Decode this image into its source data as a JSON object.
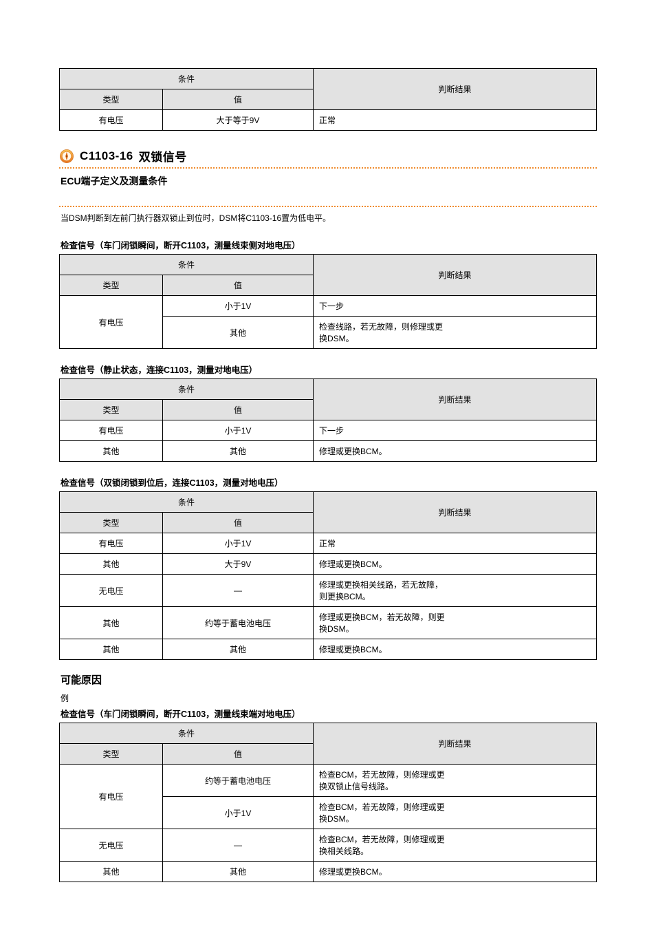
{
  "table0": {
    "h_cond": "条件",
    "h_res": "判断结果",
    "h_type": "类型",
    "h_val": "值",
    "rows": [
      {
        "type": "有电压",
        "val": "大于等于9V",
        "res": "正常"
      }
    ]
  },
  "section": {
    "id": "C1103-16",
    "name": "双锁信号"
  },
  "heading1": "ECU端子定义及测量条件",
  "intro": "当DSM判断到左前门执行器双锁止到位时，DSM将C1103-16置为低电平。",
  "tableA_title": "检查信号（车门闭锁瞬间，断开C1103，测量线束侧对地电压）",
  "tableA": {
    "h_cond": "条件",
    "h_res": "判断结果",
    "h_type": "类型",
    "h_val": "值",
    "rows": [
      {
        "type": "有电压",
        "val": "小于1V",
        "res": "下一步"
      },
      {
        "type": "",
        "val": "其他",
        "res": "检查线路，若无故障，则修理或更\n换DSM。"
      }
    ]
  },
  "tableB_title": "检查信号（静止状态，连接C1103，测量对地电压）",
  "tableB": {
    "h_cond": "条件",
    "h_res": "判断结果",
    "h_type": "类型",
    "h_val": "值",
    "rows": [
      {
        "type": "有电压",
        "val": "小于1V",
        "res": "下一步"
      },
      {
        "type": "其他",
        "val": "其他",
        "res": "修理或更换BCM。"
      }
    ]
  },
  "tableC_title": "检查信号（双锁闭锁到位后，连接C1103，测量对地电压）",
  "tableC": {
    "h_cond": "条件",
    "h_res": "判断结果",
    "h_type": "类型",
    "h_val": "值",
    "rows": [
      {
        "type": "有电压",
        "val": "小于1V",
        "res": "正常"
      },
      {
        "type": "其他",
        "val": "大于9V",
        "res": "修理或更换BCM。"
      },
      {
        "type": "无电压",
        "val": "―",
        "res": "修理或更换相关线路，若无故障，\n则更换BCM。"
      },
      {
        "type": "其他",
        "val": "约等于蓄电池电压",
        "res": "修理或更换BCM，若无故障，则更\n换DSM。"
      },
      {
        "type": "其他",
        "val": "其他",
        "res": "修理或更换BCM。"
      }
    ]
  },
  "heading2": "可能原因",
  "eg": "例",
  "tableD_title": "检查信号（车门闭锁瞬间，断开C1103，测量线束端对地电压）",
  "tableD": {
    "h_cond": "条件",
    "h_res": "判断结果",
    "h_type": "类型",
    "h_val": "值",
    "rows": [
      {
        "type": "有电压",
        "val": "约等于蓄电池电压",
        "res": "检查BCM，若无故障，则修理或更\n换双锁止信号线路。"
      },
      {
        "type": "",
        "val": "小于1V",
        "res": "检查BCM，若无故障，则修理或更\n换DSM。"
      },
      {
        "type": "无电压",
        "val": "―",
        "res": "检查BCM，若无故障，则修理或更\n换相关线路。"
      },
      {
        "type": "其他",
        "val": "其他",
        "res": "修理或更换BCM。"
      }
    ]
  }
}
